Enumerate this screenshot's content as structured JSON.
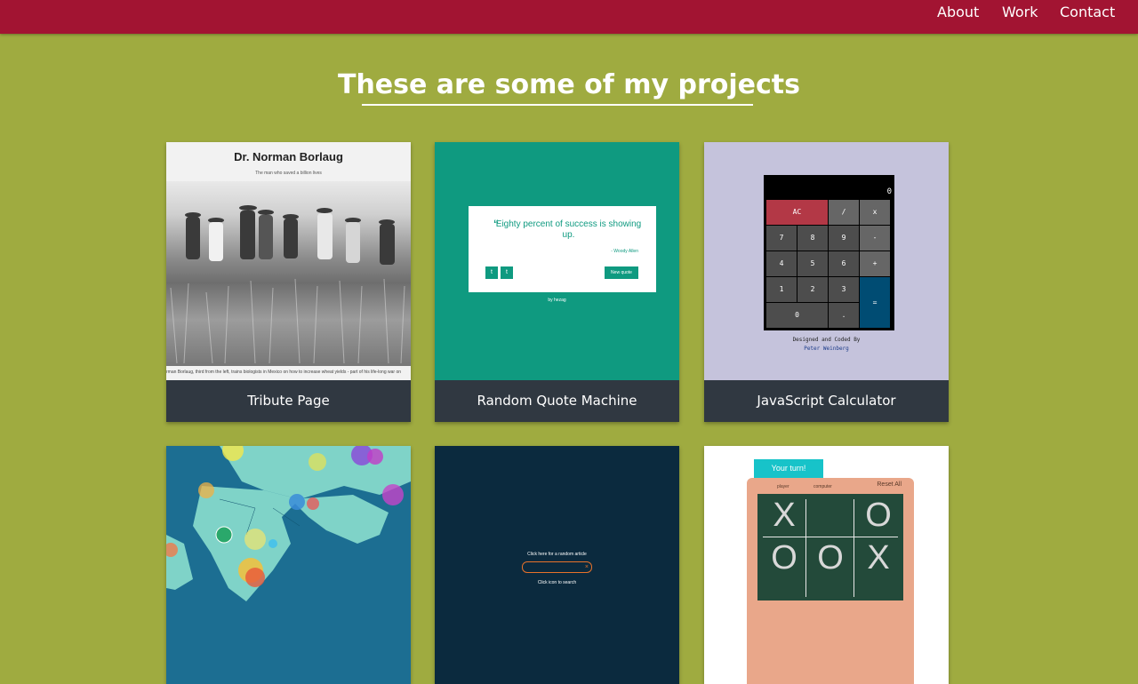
{
  "nav": {
    "items": [
      {
        "label": "About"
      },
      {
        "label": "Work"
      },
      {
        "label": "Contact"
      }
    ]
  },
  "section": {
    "heading": "These are some of my projects"
  },
  "colors": {
    "navbar": "#a21432",
    "background": "#9fab40",
    "caption_bar": "#303841",
    "quote_green": "#0f9a80",
    "calc_lavender": "#c5c3dc",
    "wiki_navy": "#0b2a3e"
  },
  "projects": [
    {
      "caption": "Tribute Page",
      "thumb": {
        "title": "Dr. Norman Borlaug",
        "subtitle": "The man who saved a billion lives",
        "photo_caption": "rman Borlaug, third from the left, trains biologists in Mexico on how to increase wheat yields - part of his life-long war on"
      }
    },
    {
      "caption": "Random Quote Machine",
      "thumb": {
        "quote": "Eighty percent of success is showing up.",
        "author": "- Woody Allen",
        "button": "New quote",
        "credit": "by hezag",
        "twitter_icon": "twitter-icon",
        "tumblr_icon": "tumblr-icon"
      }
    },
    {
      "caption": "JavaScript Calculator",
      "thumb": {
        "display": "0",
        "keys": [
          "AC",
          "/",
          "x",
          "7",
          "8",
          "9",
          "-",
          "4",
          "5",
          "6",
          "+",
          "1",
          "2",
          "3",
          "=",
          "0",
          "."
        ],
        "designed": "Designed and Coded By",
        "author": "Peter Weinberg"
      }
    },
    {
      "caption": "",
      "thumb": {
        "kind": "map-visualization"
      }
    },
    {
      "caption": "",
      "thumb": {
        "random_text": "Click here for a random article",
        "search_hint": "Click icon to search",
        "close_icon": "close-icon"
      }
    },
    {
      "caption": "",
      "thumb": {
        "turn_label": "Your turn!",
        "player_label": "player",
        "computer_label": "computer",
        "reset": "Reset All",
        "board": [
          "X",
          "",
          "O",
          "O",
          "O",
          "X"
        ]
      }
    }
  ]
}
